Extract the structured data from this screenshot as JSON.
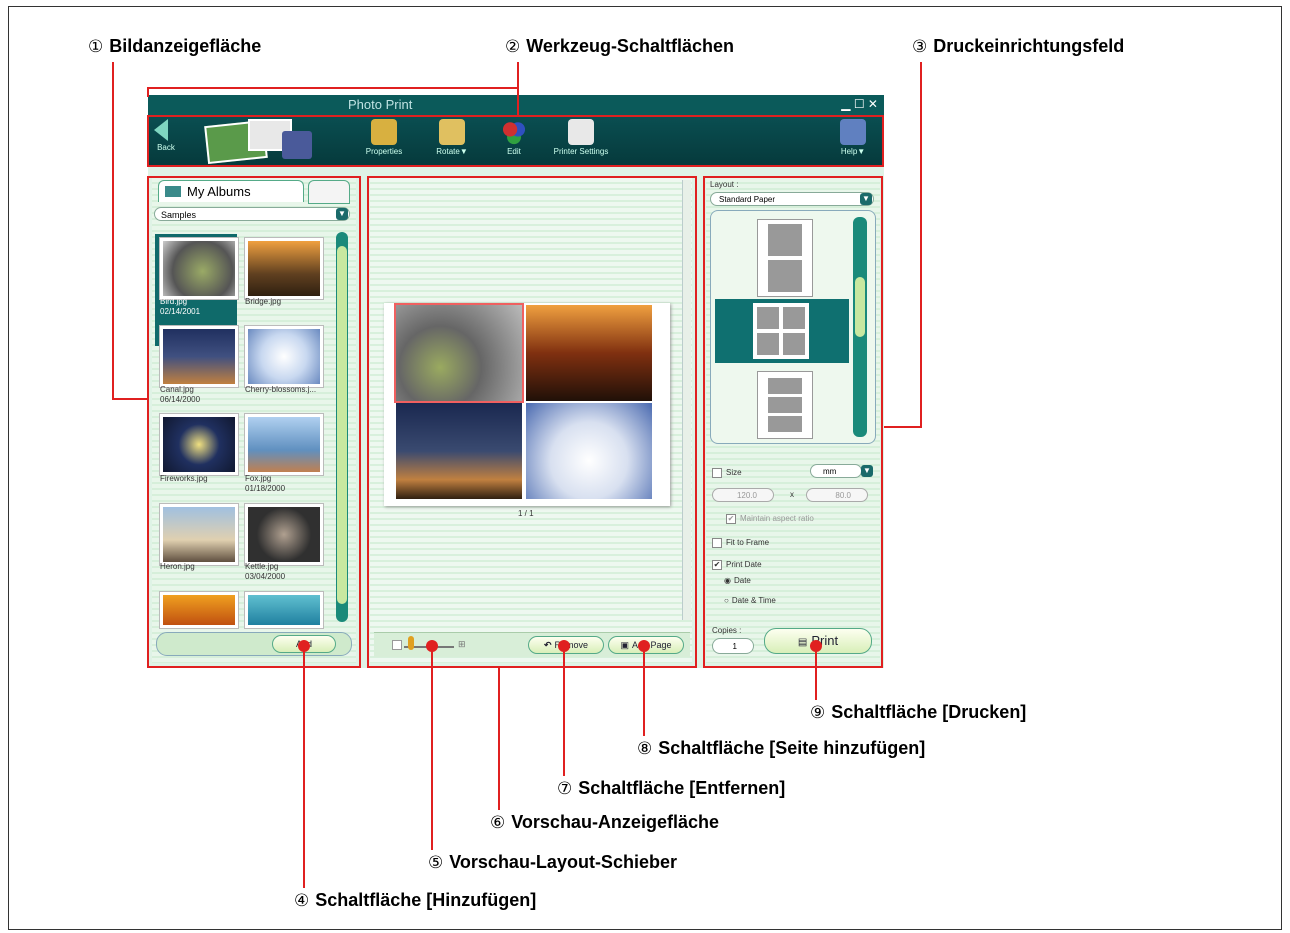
{
  "callouts": {
    "c1": {
      "num": "①",
      "label": "Bildanzeigefläche"
    },
    "c2": {
      "num": "②",
      "label": "Werkzeug-Schaltflächen"
    },
    "c3": {
      "num": "③",
      "label": "Druckeinrichtungsfeld"
    },
    "c4": {
      "num": "④",
      "label": "Schaltfläche [Hinzufügen]"
    },
    "c5": {
      "num": "⑤",
      "label": "Vorschau-Layout-Schieber"
    },
    "c6": {
      "num": "⑥",
      "label": "Vorschau-Anzeigefläche"
    },
    "c7": {
      "num": "⑦",
      "label": "Schaltfläche [Entfernen]"
    },
    "c8": {
      "num": "⑧",
      "label": "Schaltfläche [Seite hinzufügen]"
    },
    "c9": {
      "num": "⑨",
      "label": "Schaltfläche [Drucken]"
    }
  },
  "app": {
    "title": "Photo Print",
    "back_label": "Back",
    "toolbar": {
      "properties": "Properties",
      "rotate": "Rotate▼",
      "edit": "Edit",
      "printer": "Printer Settings",
      "help": "Help▼"
    },
    "albums": {
      "tab": "My Albums",
      "folder": "Samples",
      "items": [
        {
          "name": "Bird.jpg",
          "date": "02/14/2001"
        },
        {
          "name": "Bridge.jpg",
          "date": ""
        },
        {
          "name": "Canal.jpg",
          "date": "06/14/2000"
        },
        {
          "name": "Cherry-blossoms.j...",
          "date": ""
        },
        {
          "name": "Fireworks.jpg",
          "date": ""
        },
        {
          "name": "Fox.jpg",
          "date": "01/18/2000"
        },
        {
          "name": "Heron.jpg",
          "date": ""
        },
        {
          "name": "Kettle.jpg",
          "date": "03/04/2000"
        }
      ],
      "add_label": "Add"
    },
    "preview": {
      "page": "1 / 1",
      "remove_label": "Remove",
      "add_page_label": "Add Page"
    },
    "setup": {
      "layout_label": "Layout :",
      "layout_value": "Standard Paper",
      "size_label": "Size",
      "unit": "mm",
      "width": "120.0",
      "height": "80.0",
      "times": "x",
      "aspect": "Maintain aspect ratio",
      "fit": "Fit to Frame",
      "print_date": "Print Date",
      "date": "Date",
      "date_time": "Date & Time",
      "copies_label": "Copies :",
      "copies": "1",
      "print_label": "Print"
    }
  }
}
